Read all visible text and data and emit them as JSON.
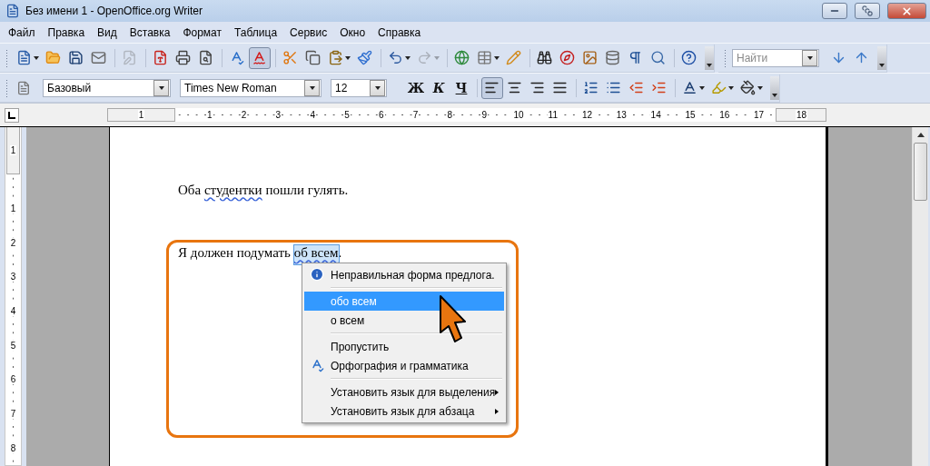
{
  "window": {
    "title": "Без имени 1 - OpenOffice.org Writer"
  },
  "menu": [
    "Файл",
    "Правка",
    "Вид",
    "Вставка",
    "Формат",
    "Таблица",
    "Сервис",
    "Окно",
    "Справка"
  ],
  "standard_toolbar": [
    [
      {
        "kind": "new",
        "disabled": false,
        "pressed": false
      },
      {
        "kind": "open",
        "disabled": false,
        "pressed": false
      },
      {
        "kind": "save",
        "disabled": false,
        "pressed": false
      },
      {
        "kind": "email",
        "disabled": false,
        "pressed": false
      }
    ],
    [
      {
        "kind": "edit",
        "disabled": true,
        "pressed": false
      }
    ],
    [
      {
        "kind": "pdf",
        "disabled": false,
        "pressed": false
      },
      {
        "kind": "print",
        "disabled": false,
        "pressed": false
      },
      {
        "kind": "preview",
        "disabled": false,
        "pressed": false
      }
    ],
    [
      {
        "kind": "spellcheck",
        "disabled": false,
        "pressed": false
      },
      {
        "kind": "autospell",
        "disabled": false,
        "pressed": true
      }
    ],
    [
      {
        "kind": "cut",
        "disabled": false,
        "pressed": false
      },
      {
        "kind": "copy",
        "disabled": false,
        "pressed": false
      },
      {
        "kind": "paste",
        "disabled": false,
        "pressed": false
      },
      {
        "kind": "brush",
        "disabled": false,
        "pressed": false
      }
    ],
    [
      {
        "kind": "undo",
        "disabled": false,
        "pressed": false
      },
      {
        "kind": "redo",
        "disabled": true,
        "pressed": false
      }
    ],
    [
      {
        "kind": "hyperlink",
        "disabled": false,
        "pressed": false
      },
      {
        "kind": "table",
        "disabled": false,
        "pressed": false
      },
      {
        "kind": "draw",
        "disabled": false,
        "pressed": false
      }
    ],
    [
      {
        "kind": "find",
        "disabled": false,
        "pressed": false
      },
      {
        "kind": "navigator",
        "disabled": false,
        "pressed": false
      },
      {
        "kind": "gallery",
        "disabled": false,
        "pressed": false
      },
      {
        "kind": "database",
        "disabled": false,
        "pressed": false
      },
      {
        "kind": "pilcrow",
        "disabled": false,
        "pressed": false
      },
      {
        "kind": "zoom",
        "disabled": false,
        "pressed": false
      }
    ],
    [
      {
        "kind": "help",
        "disabled": false,
        "pressed": false
      }
    ]
  ],
  "find_toolbar": {
    "placeholder": "Найти"
  },
  "formatting_toolbar": {
    "style": "Базовый",
    "font": "Times New Roman",
    "size": "12",
    "text_styles": [
      {
        "kind": "bold",
        "label": "Ж",
        "pressed": false
      },
      {
        "kind": "italic",
        "label": "К",
        "pressed": false
      },
      {
        "kind": "underline",
        "label": "Ч",
        "pressed": false
      }
    ],
    "alignment": [
      {
        "kind": "left",
        "selected": true
      },
      {
        "kind": "center",
        "selected": false
      },
      {
        "kind": "right",
        "selected": false
      },
      {
        "kind": "justify",
        "selected": false
      }
    ]
  },
  "horizontal_ruler": [
    "1",
    "1",
    "2",
    "3",
    "4",
    "5",
    "6",
    "7",
    "8",
    "9",
    "10",
    "11",
    "12",
    "13",
    "14",
    "15",
    "16",
    "17",
    "18"
  ],
  "vertical_ruler": [
    "1",
    "1",
    "2",
    "3",
    "4",
    "5",
    "6",
    "7",
    "8"
  ],
  "document": {
    "paragraphs": [
      {
        "segments": [
          {
            "text": "Оба ",
            "flagged": false,
            "selected": false
          },
          {
            "text": "студентки",
            "flagged": true,
            "selected": false
          },
          {
            "text": " пошли гулять.",
            "flagged": false,
            "selected": false
          }
        ]
      },
      {
        "segments": [
          {
            "text": "Я должен подумать ",
            "flagged": false,
            "selected": false
          },
          {
            "text": "об всем",
            "flagged": true,
            "selected": true
          },
          {
            "text": ".",
            "flagged": false,
            "selected": false
          }
        ]
      }
    ]
  },
  "context_menu": {
    "items": [
      {
        "kind": "message",
        "label": "Неправильная форма предлога.",
        "selected": false
      },
      {
        "kind": "separator"
      },
      {
        "kind": "suggestion",
        "label": "обо всем",
        "selected": true
      },
      {
        "kind": "suggestion",
        "label": "о всем",
        "selected": false
      },
      {
        "kind": "separator"
      },
      {
        "kind": "command",
        "label": "Пропустить",
        "selected": false
      },
      {
        "kind": "spelling",
        "label": "Орфография и грамматика",
        "selected": false
      },
      {
        "kind": "separator"
      },
      {
        "kind": "submenu",
        "label": "Установить язык для выделения",
        "selected": false
      },
      {
        "kind": "submenu",
        "label": "Установить язык для абзаца",
        "selected": false
      }
    ]
  }
}
